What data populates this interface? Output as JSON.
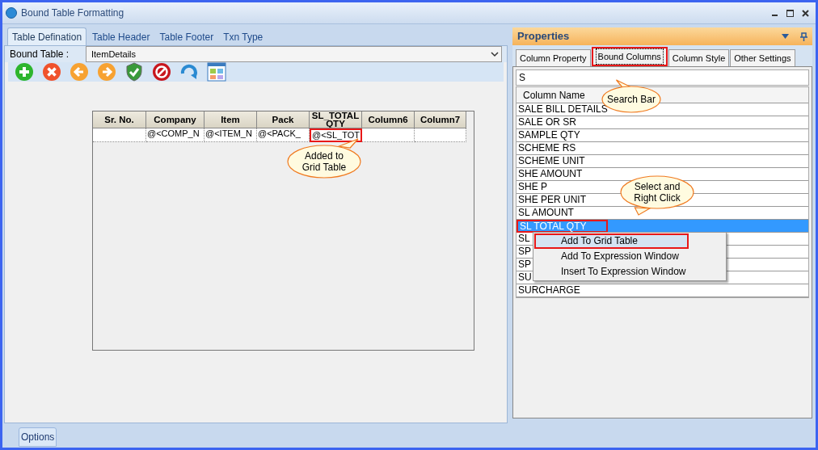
{
  "window": {
    "title": "Bound Table Formatting"
  },
  "left_tabs": [
    {
      "label": "Table Defination",
      "selected": true
    },
    {
      "label": "Table Header",
      "selected": false
    },
    {
      "label": "Table Footer",
      "selected": false
    },
    {
      "label": "Txn Type",
      "selected": false
    }
  ],
  "bound_table": {
    "label": "Bound Table :",
    "value": "ItemDetails"
  },
  "grid": {
    "columns": [
      {
        "label": "Sr. No."
      },
      {
        "label": "Company"
      },
      {
        "label": "Item"
      },
      {
        "label": "Pack"
      },
      {
        "label": "SL_TOTAL QTY"
      },
      {
        "label": "Column6"
      },
      {
        "label": "Column7"
      }
    ],
    "row": [
      {
        "highlighted": false
      },
      {
        "text": "@<COMP_N",
        "highlighted": false
      },
      {
        "text": "@<ITEM_N",
        "highlighted": false
      },
      {
        "text": "@<PACK_",
        "highlighted": false
      },
      {
        "text": "@<SL_TOT",
        "highlighted": true
      },
      {
        "highlighted": false
      },
      {
        "highlighted": false
      }
    ]
  },
  "callouts": [
    {
      "text": "Added to Grid Table"
    },
    {
      "text": "Search Bar"
    },
    {
      "text": "Select and Right Click"
    }
  ],
  "properties": {
    "title": "Properties",
    "tabs": [
      {
        "label": "Column Property",
        "selected": false
      },
      {
        "label": "Bound Columns",
        "selected": true
      },
      {
        "label": "Column Style",
        "selected": false
      },
      {
        "label": "Other Settings",
        "selected": false
      }
    ],
    "search": {
      "value": "S"
    },
    "list": {
      "header": "Column Name",
      "rows": [
        {
          "name": "SALE BILL DETAILS",
          "selected": false
        },
        {
          "name": "SALE OR SR",
          "selected": false
        },
        {
          "name": "SAMPLE QTY",
          "selected": false
        },
        {
          "name": "SCHEME RS",
          "selected": false
        },
        {
          "name": "SCHEME UNIT",
          "selected": false
        },
        {
          "name": "SHE AMOUNT",
          "selected": false
        },
        {
          "name": "SHE P",
          "selected": false
        },
        {
          "name": "SHE PER UNIT",
          "selected": false
        },
        {
          "name": "SL AMOUNT",
          "selected": false
        },
        {
          "name": "SL TOTAL QTY",
          "selected": true
        },
        {
          "name": "SL",
          "selected": false
        },
        {
          "name": "SP",
          "selected": false
        },
        {
          "name": "SP",
          "selected": false
        },
        {
          "name": "SU",
          "selected": false
        },
        {
          "name": "SURCHARGE",
          "selected": false
        }
      ]
    }
  },
  "context_menu": {
    "items": [
      {
        "label": "Add To Grid Table",
        "selected": true
      },
      {
        "label": "Add To Expression Window",
        "selected": false
      },
      {
        "label": "Insert To Expression Window",
        "selected": false
      }
    ]
  },
  "status_bar": {
    "button": "Options"
  }
}
